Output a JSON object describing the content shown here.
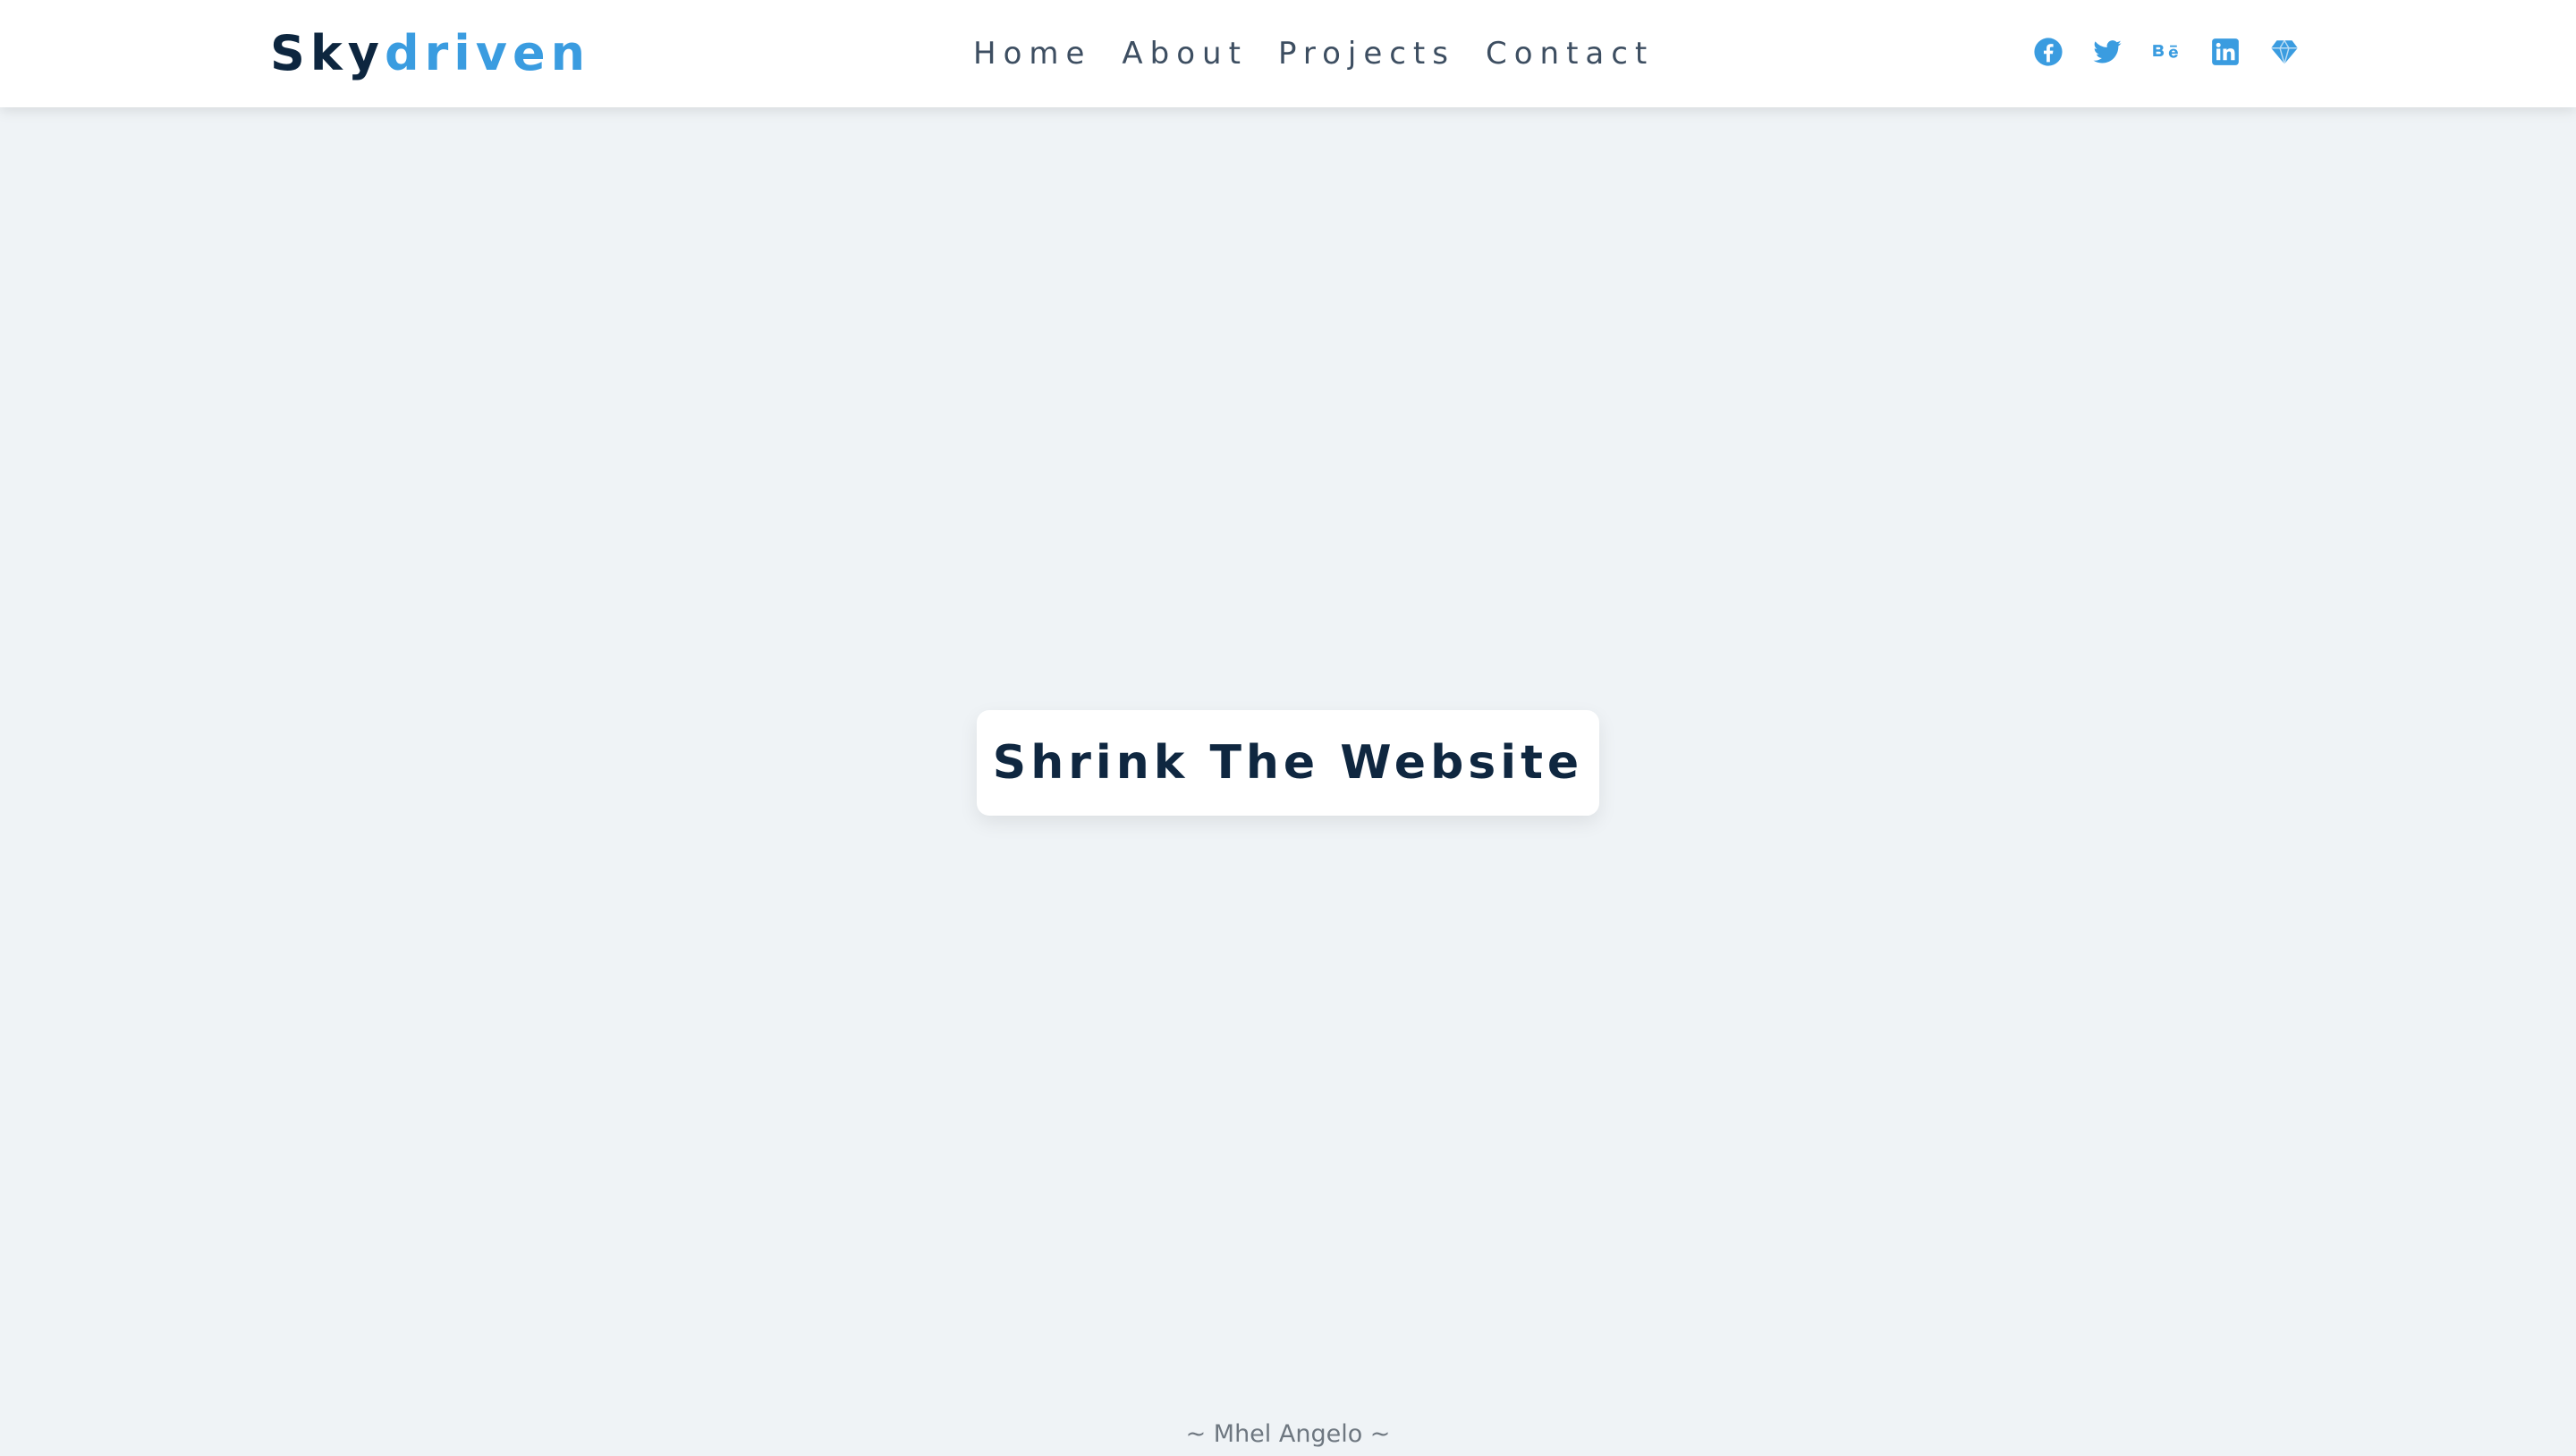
{
  "brand": {
    "part1": "Sky",
    "part2": "driven"
  },
  "nav": {
    "links": [
      {
        "label": "Home"
      },
      {
        "label": "About"
      },
      {
        "label": "Projects"
      },
      {
        "label": "Contact"
      }
    ]
  },
  "social": {
    "icons": [
      "facebook-icon",
      "twitter-icon",
      "behance-icon",
      "linkedin-icon",
      "gem-icon"
    ]
  },
  "hero": {
    "title": "Shrink The Website"
  },
  "footer": {
    "credit": "~ Mhel Angelo ~"
  },
  "colors": {
    "accent": "#3a9ce0",
    "dark": "#0d263f",
    "background": "#eff3f6"
  }
}
